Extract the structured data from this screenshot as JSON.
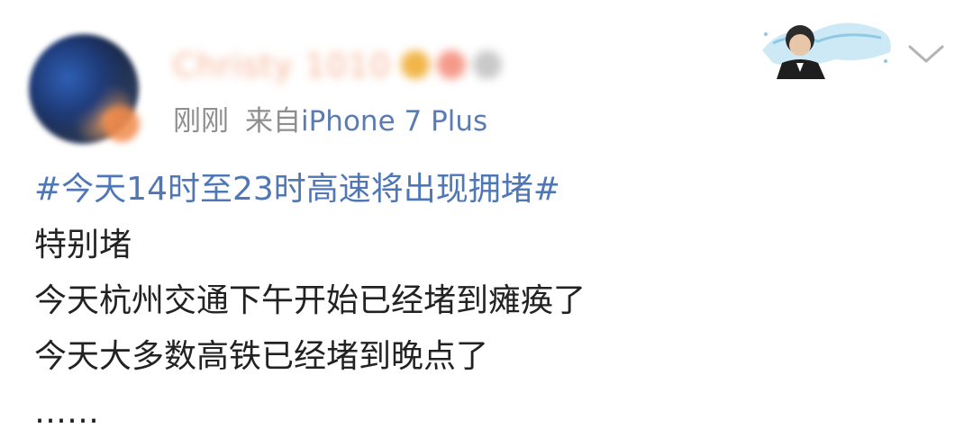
{
  "post": {
    "username": "Christy 1010",
    "timestamp": "刚刚",
    "source_prefix": "来自",
    "source_device": "iPhone 7 Plus",
    "topic": "#今天14时至23时高速将出现拥堵#",
    "lines": [
      "特别堵",
      "今天杭州交通下午开始已经堵到瘫痪了",
      "今天大多数高铁已经堵到晚点了",
      "……"
    ]
  },
  "icons": {
    "expand": "chevron-down-icon",
    "decoration": "card-decoration-portrait"
  },
  "colors": {
    "topic": "#4f77b6",
    "source_device": "#5b7cb3",
    "meta": "#8e8e8e",
    "text": "#222222"
  }
}
